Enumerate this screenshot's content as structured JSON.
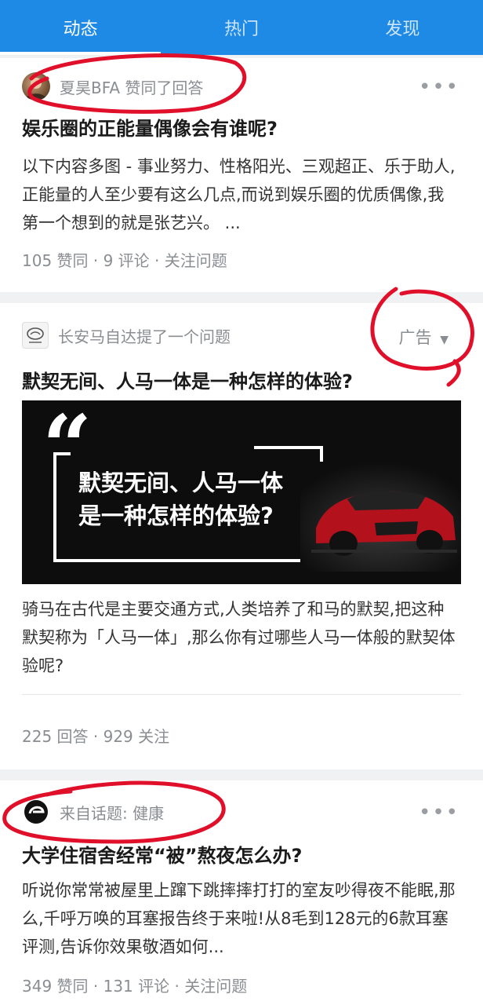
{
  "tabs": [
    {
      "label": "动态",
      "active": true
    },
    {
      "label": "热门",
      "active": false
    },
    {
      "label": "发现",
      "active": false
    }
  ],
  "cards": [
    {
      "meta": "夏昊BFA 赞同了回答",
      "title": "娱乐圈的正能量偶像会有谁呢?",
      "excerpt": "以下内容多图 - 事业努力、性格阳光、三观超正、乐于助人,正能量的人至少要有这么几点,而说到娱乐圈的优质偶像,我第一个想到的就是张艺兴。 ...",
      "stats": "105 赞同 · 9 评论 · 关注问题"
    },
    {
      "meta": "长安马自达提了一个问题",
      "ad_label": "广告",
      "title": "默契无间、人马一体是一种怎样的体验?",
      "banner_line1": "默契无间、人马一体",
      "banner_line2": "是一种怎样的体验?",
      "banner_quote": "“",
      "excerpt": "骑马在古代是主要交通方式,人类培养了和马的默契,把这种默契称为「人马一体」,那么你有过哪些人马一体般的默契体验呢?",
      "stats": "225 回答 · 929 关注"
    },
    {
      "meta": "来自话题: 健康",
      "title": "大学住宿舍经常“被”熬夜怎么办?",
      "excerpt": "听说你常常被屋里上蹿下跳摔摔打打的室友吵得夜不能眠,那么,千呼万唤的耳塞报告终于来啦!从8毛到128元的6款耳塞评测,告诉你效果敬酒如何...",
      "stats": "349 赞同 · 131 评论 · 关注问题"
    }
  ],
  "more_glyph": "•••",
  "colors": {
    "accent": "#1e8ae6",
    "annotation": "#e0102a"
  }
}
